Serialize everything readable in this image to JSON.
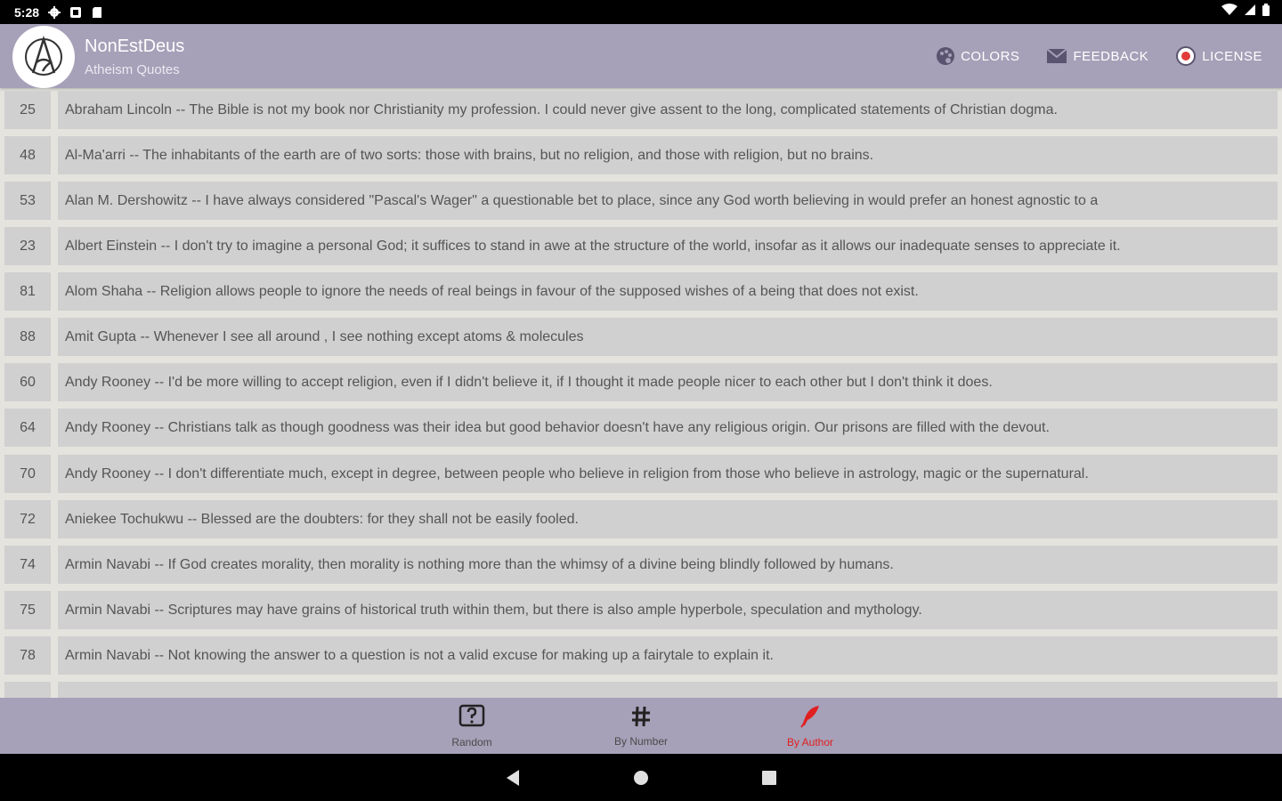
{
  "status_bar": {
    "time": "5:28",
    "left_icons": [
      "settings-gear-icon",
      "screenshot-icon",
      "sd-card-icon"
    ],
    "right_icons": [
      "wifi-icon",
      "cell-signal-icon",
      "battery-icon"
    ]
  },
  "app_bar": {
    "title": "NonEstDeus",
    "subtitle": "Atheism Quotes",
    "logo_icon": "atheism-symbol-icon",
    "actions": [
      {
        "label": "COLORS",
        "icon": "palette-icon"
      },
      {
        "label": "FEEDBACK",
        "icon": "mail-icon"
      },
      {
        "label": "LICENSE",
        "icon": "license-icon"
      }
    ]
  },
  "quotes": [
    {
      "number": "25",
      "text": "Abraham Lincoln -- The Bible is not my book nor Christianity my profession. I could never give assent to the long, complicated statements of Christian dogma."
    },
    {
      "number": "48",
      "text": "Al-Ma'arri -- The inhabitants of the earth are of two sorts: those with brains, but no religion, and those with religion, but no brains."
    },
    {
      "number": "53",
      "text": "Alan M. Dershowitz -- I have always considered \"Pascal's Wager\" a questionable bet to place, since any God worth believing in would prefer an honest agnostic to a"
    },
    {
      "number": "23",
      "text": "Albert Einstein -- I don't try to imagine a personal God; it suffices to stand in awe at the structure of the world, insofar as it allows our inadequate senses to appreciate it."
    },
    {
      "number": "81",
      "text": "Alom Shaha -- Religion allows people to ignore the needs of real beings in favour of the supposed wishes of a being that does not exist."
    },
    {
      "number": "88",
      "text": "Amit Gupta -- Whenever I see all around , I see nothing except atoms & molecules"
    },
    {
      "number": "60",
      "text": "Andy Rooney -- I'd be more willing to accept religion, even if I didn't believe it, if I thought it made people nicer to each other but I don't think it does."
    },
    {
      "number": "64",
      "text": "Andy Rooney -- Christians talk as though goodness was their idea but good behavior doesn't have any religious origin. Our prisons are filled with the devout."
    },
    {
      "number": "70",
      "text": "Andy Rooney -- I don't differentiate much, except in degree, between people who believe in religion from those who believe in astrology, magic or the supernatural."
    },
    {
      "number": "72",
      "text": "Aniekee Tochukwu -- Blessed are the doubters: for they shall not be easily fooled."
    },
    {
      "number": "74",
      "text": "Armin Navabi -- If God creates morality, then morality is nothing more than the whimsy of a divine being blindly followed by humans."
    },
    {
      "number": "75",
      "text": "Armin Navabi -- Scriptures may have grains of historical truth within them, but there is also ample hyperbole, speculation and mythology."
    },
    {
      "number": "78",
      "text": "Armin Navabi -- Not knowing the answer to a question is not a valid excuse for making up a fairytale to explain it."
    }
  ],
  "bottom_nav": [
    {
      "label": "Random",
      "icon": "question-box-icon",
      "active": false
    },
    {
      "label": "By Number",
      "icon": "hash-icon",
      "active": false
    },
    {
      "label": "By Author",
      "icon": "quill-icon",
      "active": true
    }
  ],
  "colors": {
    "app_bar": "#a6a0b8",
    "row_bg": "#d0d0d0",
    "page_bg": "#e4e3de",
    "active_nav": "#e02020"
  },
  "system_nav": [
    "back-icon",
    "home-icon",
    "recents-icon"
  ]
}
